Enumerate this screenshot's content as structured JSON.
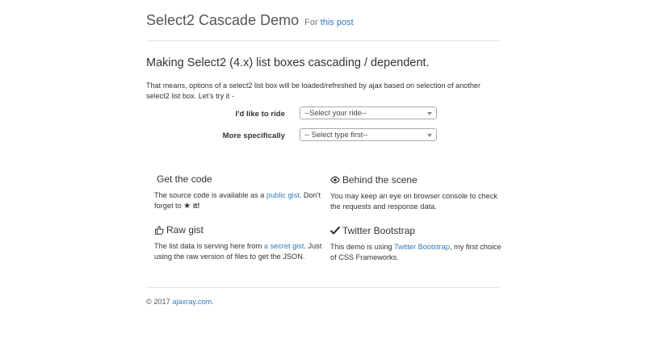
{
  "header": {
    "title": "Select2 Cascade Demo",
    "for_text": "For",
    "post_link": "this post"
  },
  "main": {
    "heading": "Making Select2 (4.x) list boxes cascading / dependent.",
    "intro": "That means, options of a select2 list box will be loaded/refreshed by ajax based on selection of another select2 list box. Let's try it -",
    "form": {
      "ride_label": "I'd like to ride",
      "ride_value": "--Select your ride--",
      "type_label": "More specifically",
      "type_value": "-- Select type first--"
    }
  },
  "features": {
    "code": {
      "title": "Get the code",
      "text1": "The source code is available as a",
      "link": "public gist",
      "text2": ". Don't forget to",
      "star": "★",
      "text3": "it!"
    },
    "scene": {
      "icon": "eye-icon",
      "title": "Behind the scene",
      "text": "You may keep an eye on browser console to check the requests and response data."
    },
    "gist": {
      "icon": "thumbs-up-icon",
      "title": "Raw gist",
      "text1": "The list data is serving here from",
      "link": "a secret gist",
      "text2": ". Just using the raw version of files to get the JSON."
    },
    "bootstrap": {
      "icon": "check-icon",
      "title": "Twitter Bootstrap",
      "text1": "This demo is using",
      "link": "Twitter Bootstrap",
      "text2": ", my first choice of CSS Frameworks."
    }
  },
  "footer": {
    "copyright": "© 2017",
    "link": "ajaxray.com",
    "dot": "."
  },
  "colors": {
    "link": "#337ab7",
    "text": "#333333",
    "header": "#555555",
    "divider": "#e5e5e5"
  }
}
